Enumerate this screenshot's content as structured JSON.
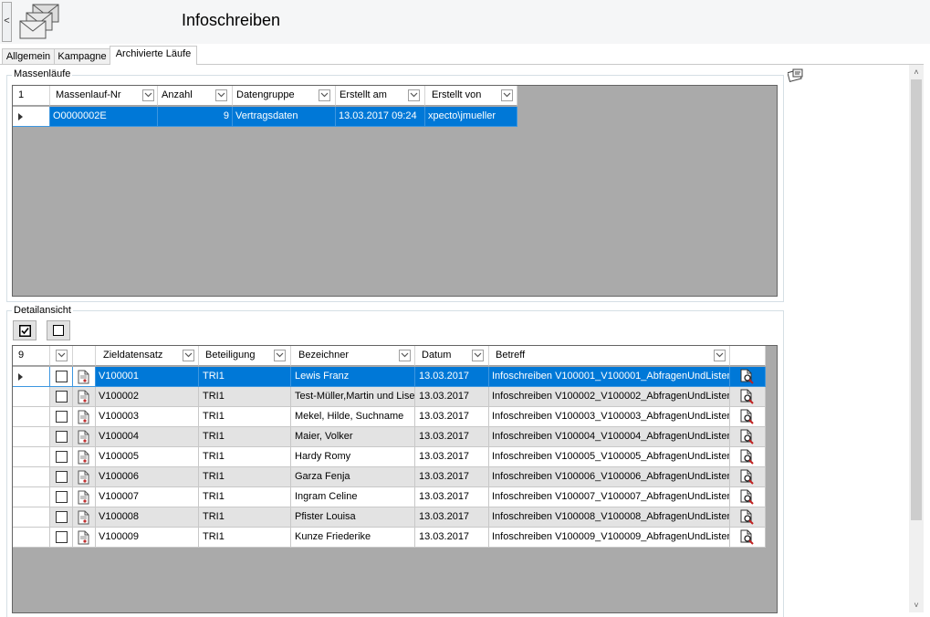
{
  "header": {
    "back_label": "<",
    "title": "Infoschreiben",
    "app_icon": "envelopes-icon"
  },
  "tabs": [
    {
      "label": "Allgemein",
      "active": false
    },
    {
      "label": "Kampagne",
      "active": false
    },
    {
      "label": "Archivierte Läufe",
      "active": true
    }
  ],
  "massenlaeufe": {
    "group_label": "Massenläufe",
    "row_count": "1",
    "columns": [
      "Massenlauf-Nr",
      "Anzahl",
      "Datengruppe",
      "Erstellt am",
      "Erstellt von"
    ],
    "rows": [
      {
        "nr": "O0000002E",
        "anzahl": "9",
        "datengruppe": "Vertragsdaten",
        "erstellt_am": "13.03.2017 09:24",
        "erstellt_von": "xpecto\\jmueller"
      }
    ]
  },
  "detailansicht": {
    "group_label": "Detailansicht",
    "select_all_icon": "checkbox-checked-icon",
    "deselect_all_icon": "checkbox-empty-icon",
    "row_count": "9",
    "columns": [
      "Zieldatensatz",
      "Beteiligung",
      "Bezeichner",
      "Datum",
      "Betreff"
    ],
    "rows": [
      {
        "ziel": "V100001",
        "beteiligung": "TRI1",
        "bezeichner": "Lewis Franz",
        "datum": "13.03.2017",
        "betreff": "Infoschreiben V100001_V100001_AbfragenUndListen"
      },
      {
        "ziel": "V100002",
        "beteiligung": "TRI1",
        "bezeichner": "Test-Müller,Martin und Lise",
        "datum": "13.03.2017",
        "betreff": "Infoschreiben V100002_V100002_AbfragenUndListen"
      },
      {
        "ziel": "V100003",
        "beteiligung": "TRI1",
        "bezeichner": "Mekel, Hilde, Suchname",
        "datum": "13.03.2017",
        "betreff": "Infoschreiben V100003_V100003_AbfragenUndListen"
      },
      {
        "ziel": "V100004",
        "beteiligung": "TRI1",
        "bezeichner": "Maier, Volker",
        "datum": "13.03.2017",
        "betreff": "Infoschreiben V100004_V100004_AbfragenUndListen"
      },
      {
        "ziel": "V100005",
        "beteiligung": "TRI1",
        "bezeichner": "Hardy Romy",
        "datum": "13.03.2017",
        "betreff": "Infoschreiben V100005_V100005_AbfragenUndListen"
      },
      {
        "ziel": "V100006",
        "beteiligung": "TRI1",
        "bezeichner": "Garza Fenja",
        "datum": "13.03.2017",
        "betreff": "Infoschreiben V100006_V100006_AbfragenUndListen"
      },
      {
        "ziel": "V100007",
        "beteiligung": "TRI1",
        "bezeichner": "Ingram Celine",
        "datum": "13.03.2017",
        "betreff": "Infoschreiben V100007_V100007_AbfragenUndListen"
      },
      {
        "ziel": "V100008",
        "beteiligung": "TRI1",
        "bezeichner": "Pfister Louisa",
        "datum": "13.03.2017",
        "betreff": "Infoschreiben V100008_V100008_AbfragenUndListen"
      },
      {
        "ziel": "V100009",
        "beteiligung": "TRI1",
        "bezeichner": "Kunze Friederike",
        "datum": "13.03.2017",
        "betreff": "Infoschreiben V100009_V100009_AbfragenUndListen"
      }
    ]
  },
  "colors": {
    "selection": "#0078d7",
    "grid_background": "#aaaaaa",
    "alt_row": "#e3e3e3"
  }
}
